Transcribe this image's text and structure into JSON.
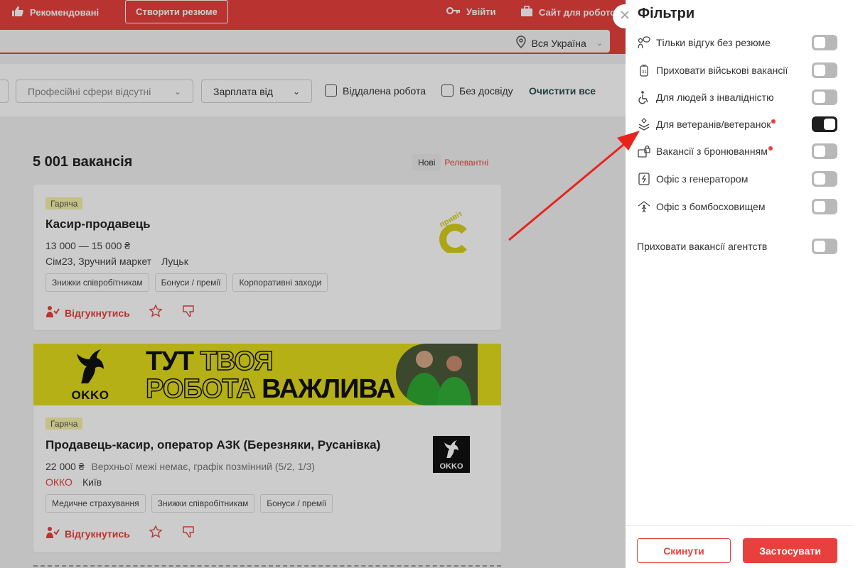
{
  "header": {
    "recommended": "Рекомендовані",
    "create_resume": "Створити резюме",
    "login": "Увійти",
    "employer_site": "Сайт для роботодавців",
    "region": "Вся Україна"
  },
  "filters_bar": {
    "professional_spheres": "Професійні сфери відсутні",
    "salary_from": "Зарплата від",
    "remote": "Віддалена робота",
    "no_experience": "Без досвіду",
    "clear_all": "Очистити все"
  },
  "results": {
    "count_title": "5 001 вакансія",
    "sort_new": "Нові",
    "sort_relevant": "Релевантні"
  },
  "vacancies": [
    {
      "badge": "Гаряча",
      "title": "Касир-продавець",
      "salary": "13 000 — 15 000 ₴",
      "salary_extra": "",
      "company": "Сім23, Зручний маркет",
      "city": "Луцьк",
      "tags": [
        "Знижки співробітникам",
        "Бонуси / премії",
        "Корпоративні заходи"
      ],
      "apply": "Відгукнутись",
      "logo_text": "привіт"
    },
    {
      "badge": "Гаряча",
      "title": "Продавець-касир, оператор АЗК (Березняки, Русанівка)",
      "salary": "22 000 ₴",
      "salary_extra": "Верхньої межі немає, графік позмінний (5/2, 1/3)",
      "company": "ОККО",
      "city": "Київ",
      "tags": [
        "Медичне страхування",
        "Знижки співробітникам",
        "Бонуси / премії"
      ],
      "apply": "Відгукнутись",
      "logo_text": "OKKO"
    }
  ],
  "banner": {
    "line1_dark": "ТУТ",
    "line1_outline": "ТВОЯ",
    "line2_outline": "РОБОТА",
    "line2_dark": "ВАЖЛИВА",
    "brand": "OKKO"
  },
  "panel": {
    "title": "Фільтри",
    "items": [
      {
        "label": "Тільки відгук без резюме",
        "on": false,
        "icon": "message-person-icon",
        "dot": false
      },
      {
        "label": "Приховати військові вакансії",
        "on": false,
        "icon": "military-tag-icon",
        "dot": false
      },
      {
        "label": "Для людей з інвалідністю",
        "on": false,
        "icon": "wheelchair-icon",
        "dot": false
      },
      {
        "label": "Для ветеранів/ветеранок",
        "on": true,
        "icon": "veteran-chevron-icon",
        "dot": true
      },
      {
        "label": "Вакансії з бронюванням",
        "on": false,
        "icon": "reservation-lock-icon",
        "dot": true
      },
      {
        "label": "Офіс з генератором",
        "on": false,
        "icon": "generator-icon",
        "dot": false
      },
      {
        "label": "Офіс з бомбосховищем",
        "on": false,
        "icon": "shelter-icon",
        "dot": false
      }
    ],
    "hide_agencies": "Приховати вакансії агентств",
    "reset": "Скинути",
    "apply": "Застосувати"
  },
  "colors": {
    "brand_red": "#e8413d",
    "toggle_on": "#1e1e1e",
    "toggle_off": "#b8b8b8",
    "banner_yellow": "#e3dd1c"
  }
}
